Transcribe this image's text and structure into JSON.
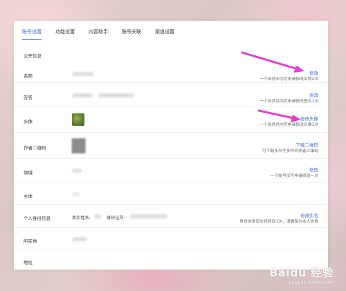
{
  "tabs": [
    "账号设置",
    "功能设置",
    "内容助手",
    "账号关联",
    "渠道设置"
  ],
  "active_tab": 0,
  "section_title": "公开信息",
  "rows": {
    "name": {
      "label": "名称",
      "action": "修改",
      "hint": "一个自然年内可申请修改名称2次"
    },
    "signature": {
      "label": "签名",
      "action": "修改",
      "hint": "一个自然月内可申请修改签名1次"
    },
    "avatar": {
      "label": "头像",
      "action": "修改头像",
      "hint": "一个自然月内可申请修改头像1次"
    },
    "qrcode": {
      "label": "作者二维码",
      "action": "下载二维码",
      "hint": "可下载多尺寸多样式作者二维码"
    },
    "domain": {
      "label": "领域",
      "action": "修改",
      "hint": "一个账号仅可申请修改一次"
    },
    "subject": {
      "label": "主体"
    },
    "identity": {
      "label": "个人身份信息",
      "real_name_label": "真实姓名:",
      "id_label": "身份证号:",
      "action": "修改实名",
      "hint": "身份信息仅支持修改1次，请确保为本人信息"
    },
    "location": {
      "label": "所在地"
    },
    "address": {
      "label": "地址"
    }
  },
  "watermark": {
    "main": "Baidu 经验",
    "sub": "jingyan.baidu.com"
  },
  "colors": {
    "accent": "#3a6fd8",
    "arrow": "#e83ad6"
  }
}
